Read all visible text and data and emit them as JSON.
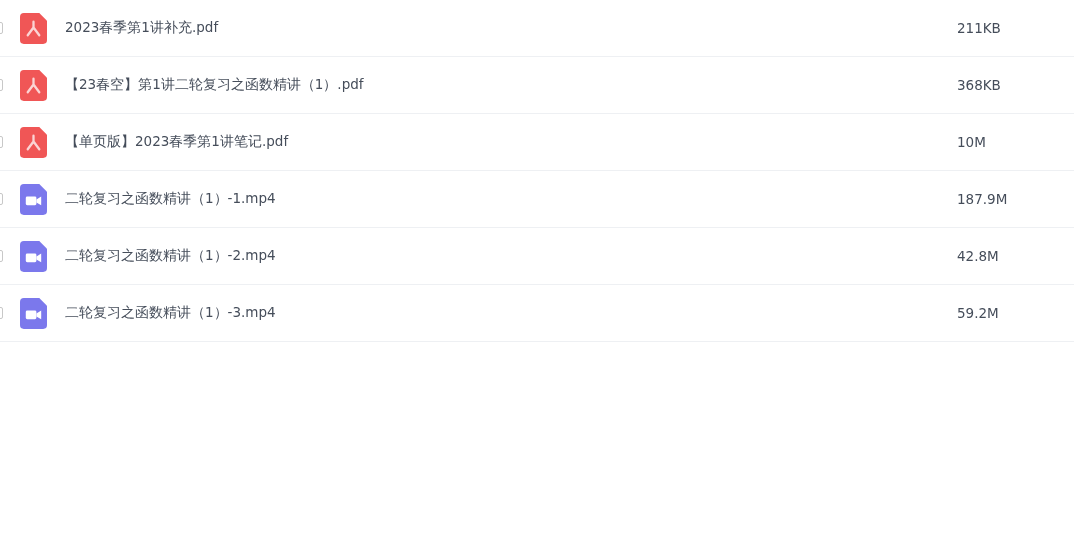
{
  "files": [
    {
      "kind": "pdf",
      "name": "2023春季第1讲补充.pdf",
      "size": "211KB",
      "checked": false
    },
    {
      "kind": "pdf",
      "name": "【23春空】第1讲二轮复习之函数精讲（1）.pdf",
      "size": "368KB",
      "checked": false
    },
    {
      "kind": "pdf",
      "name": "【单页版】2023春季第1讲笔记.pdf",
      "size": "10M",
      "checked": false
    },
    {
      "kind": "video",
      "name": "二轮复习之函数精讲（1）-1.mp4",
      "size": "187.9M",
      "checked": false
    },
    {
      "kind": "video",
      "name": "二轮复习之函数精讲（1）-2.mp4",
      "size": "42.8M",
      "checked": false
    },
    {
      "kind": "video",
      "name": "二轮复习之函数精讲（1）-3.mp4",
      "size": "59.2M",
      "checked": false
    }
  ]
}
